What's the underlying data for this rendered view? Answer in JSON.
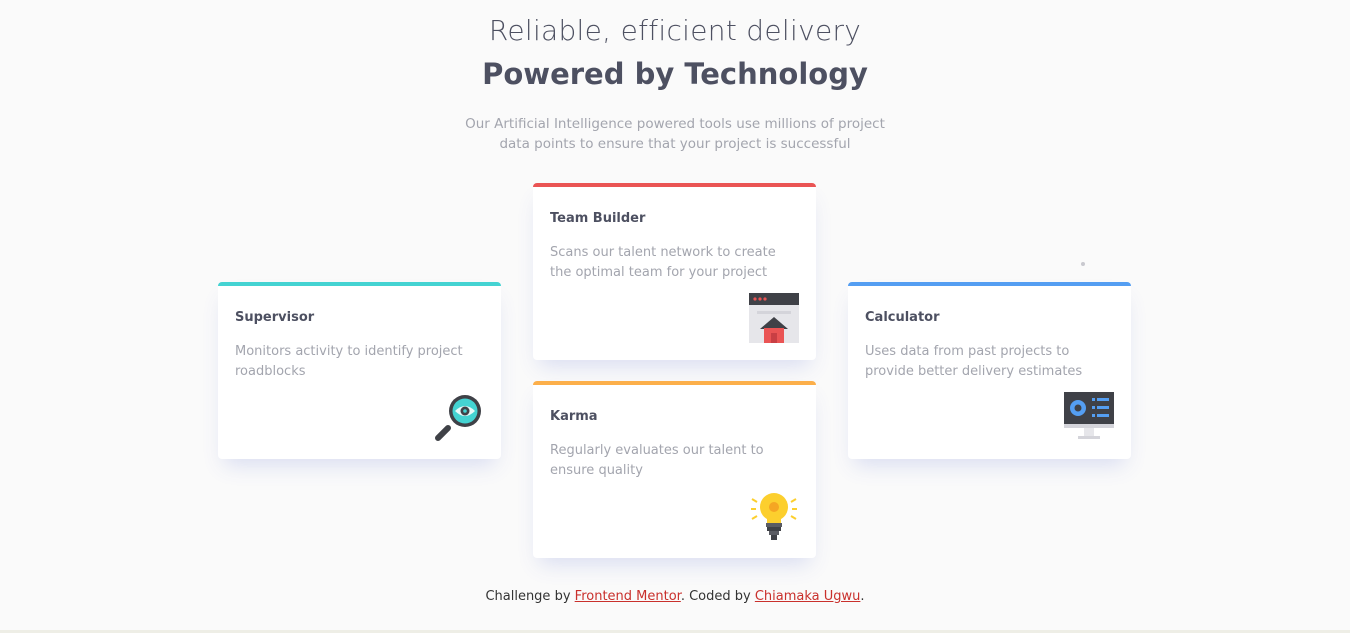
{
  "header": {
    "subtitle": "Reliable, efficient delivery",
    "title": "Powered by Technology",
    "intro": "Our Artificial Intelligence powered tools use millions of project data points to ensure that your project is successful"
  },
  "cards": {
    "supervisor": {
      "title": "Supervisor",
      "text": "Monitors activity to identify project roadblocks",
      "icon": "magnifier-eye-icon",
      "color": "#44d3d2"
    },
    "team_builder": {
      "title": "Team Builder",
      "text": "Scans our talent network to create the optimal team for your project",
      "icon": "browser-house-icon",
      "color": "#ea5454"
    },
    "karma": {
      "title": "Karma",
      "text": "Regularly evaluates our talent to ensure quality",
      "icon": "lightbulb-icon",
      "color": "#fcaf4a"
    },
    "calculator": {
      "title": "Calculator",
      "text": "Uses data from past projects to provide better delivery estimates",
      "icon": "monitor-chart-icon",
      "color": "#549ef2"
    }
  },
  "footer": {
    "prefix": "Challenge by ",
    "link1": "Frontend Mentor",
    "middle": ". Coded by ",
    "link2": "Chiamaka Ugwu",
    "suffix": "."
  }
}
